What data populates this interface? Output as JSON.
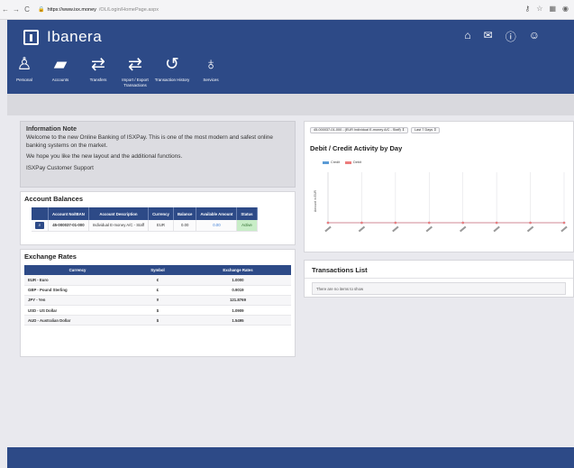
{
  "browser": {
    "url_host": "https://www.isx.money",
    "url_path": "/OL/Login/HomePage.aspx"
  },
  "app": {
    "name": "Ibanera"
  },
  "menu": [
    {
      "label": "Personal",
      "icon": "person-icon"
    },
    {
      "label": "Accounts",
      "icon": "card-icon"
    },
    {
      "label": "Transfers",
      "icon": "transfer-icon"
    },
    {
      "label": "Import / Export Transactions",
      "icon": "import-export-icon"
    },
    {
      "label": "Transaction History",
      "icon": "history-icon"
    },
    {
      "label": "Services",
      "icon": "services-icon"
    }
  ],
  "info_note": {
    "title": "Information Note",
    "p1": "Welcome to the new Online Banking of ISXPay. This is one of the most modern and safest online banking systems on the market.",
    "p2": "We hope you like the new layout and the additional functions.",
    "p3": "ISXPay Customer Support"
  },
  "account_balances": {
    "title": "Account Balances",
    "headers": [
      "",
      "Account No/IBAN",
      "Account Description",
      "Currency",
      "Balance",
      "Available Amount",
      "Status"
    ],
    "rows": [
      {
        "account": "45-000037-01-000",
        "description": "Individual E-money A/C - Staff",
        "currency": "EUR",
        "balance": "0.00",
        "available": "0.00",
        "status": "Active"
      }
    ]
  },
  "exchange_rates": {
    "title": "Exchange Rates",
    "headers": [
      "Currency",
      "Symbol",
      "Exchange Rates"
    ],
    "rows": [
      {
        "currency": "EUR - Euro",
        "symbol": "€",
        "rate": "1.0000"
      },
      {
        "currency": "GBP - Pound Sterling",
        "symbol": "£",
        "rate": "0.9019"
      },
      {
        "currency": "JPY - Yen",
        "symbol": "¥",
        "rate": "121.8769"
      },
      {
        "currency": "USD - US Dollar",
        "symbol": "$",
        "rate": "1.0909"
      },
      {
        "currency": "AUD - Australian Dollar",
        "symbol": "$",
        "rate": "1.5495"
      }
    ]
  },
  "activity": {
    "account_select": "45-000037-01-000 - (EUR Individual E-money A/C - Staff)",
    "range_select": "Last 7 Days",
    "title": "Debit / Credit Activity by Day",
    "y_axis_label": "Amount in EUR",
    "legend": [
      {
        "name": "Credit",
        "color": "#5b9bd5"
      },
      {
        "name": "Debit",
        "color": "#ec7c7c"
      }
    ]
  },
  "chart_data": {
    "type": "line",
    "title": "Debit / Credit Activity by Day",
    "ylabel": "Amount in EUR",
    "series": [
      {
        "name": "Credit",
        "values": [
          0,
          0,
          0,
          0,
          0,
          0,
          0,
          0
        ]
      },
      {
        "name": "Debit",
        "values": [
          0,
          0,
          0,
          0,
          0,
          0,
          0,
          0
        ]
      }
    ],
    "legend_position": "top-left",
    "grid": true
  },
  "transactions": {
    "title": "Transactions List",
    "empty_text": "There are no items to show"
  }
}
